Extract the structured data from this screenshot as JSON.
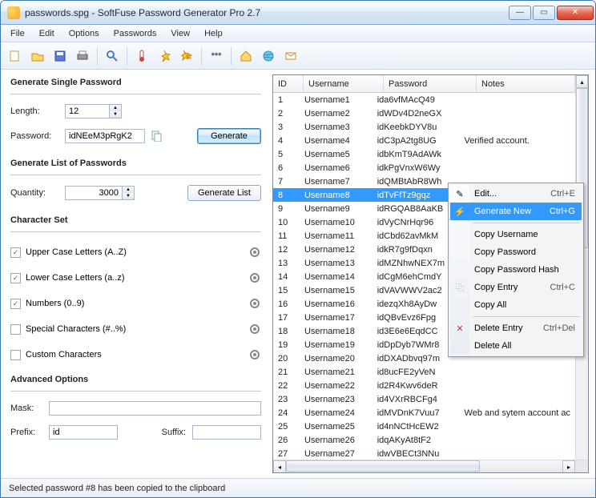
{
  "window": {
    "title": "passwords.spg - SoftFuse Password Generator Pro 2.7"
  },
  "menu": [
    "File",
    "Edit",
    "Options",
    "Passwords",
    "View",
    "Help"
  ],
  "sections": {
    "single": {
      "title": "Generate Single Password",
      "length_label": "Length:",
      "length_value": "12",
      "password_label": "Password:",
      "password_value": "idNEeM3pRgK2",
      "generate": "Generate"
    },
    "list": {
      "title": "Generate List of Passwords",
      "quantity_label": "Quantity:",
      "quantity_value": "3000",
      "generate_list": "Generate List"
    },
    "charset": {
      "title": "Character Set",
      "upper": "Upper Case Letters (A..Z)",
      "lower": "Lower Case Letters (a..z)",
      "numbers": "Numbers (0..9)",
      "special": "Special Characters (#..%)",
      "custom": "Custom Characters"
    },
    "advanced": {
      "title": "Advanced Options",
      "mask_label": "Mask:",
      "mask_value": "",
      "prefix_label": "Prefix:",
      "prefix_value": "id",
      "suffix_label": "Suffix:",
      "suffix_value": ""
    }
  },
  "grid": {
    "headers": [
      "ID",
      "Username",
      "Password",
      "Notes"
    ],
    "selected_index": 7,
    "rows": [
      {
        "id": "1",
        "user": "Username1",
        "pw": "ida6vfMAcQ49",
        "notes": ""
      },
      {
        "id": "2",
        "user": "Username2",
        "pw": "idWDv4D2neGX",
        "notes": ""
      },
      {
        "id": "3",
        "user": "Username3",
        "pw": "idKeebkDYV8u",
        "notes": ""
      },
      {
        "id": "4",
        "user": "Username4",
        "pw": "idC3pA2tg8UG",
        "notes": "Verified account."
      },
      {
        "id": "5",
        "user": "Username5",
        "pw": "idbKmT9AdAWk",
        "notes": ""
      },
      {
        "id": "6",
        "user": "Username6",
        "pw": "idkPgVnxW6Wy",
        "notes": ""
      },
      {
        "id": "7",
        "user": "Username7",
        "pw": "idQMBtAbR8Wh",
        "notes": ""
      },
      {
        "id": "8",
        "user": "Username8",
        "pw": "idTvFfTz9gqz",
        "notes": ""
      },
      {
        "id": "9",
        "user": "Username9",
        "pw": "idRGQAB8AaKB",
        "notes": ""
      },
      {
        "id": "10",
        "user": "Username10",
        "pw": "idVyCNrHqr96",
        "notes": ""
      },
      {
        "id": "11",
        "user": "Username11",
        "pw": "idCbd62avMkM",
        "notes": ""
      },
      {
        "id": "12",
        "user": "Username12",
        "pw": "idkR7g9fDqxn",
        "notes": ""
      },
      {
        "id": "13",
        "user": "Username13",
        "pw": "idMZNhwNEX7m",
        "notes": ""
      },
      {
        "id": "14",
        "user": "Username14",
        "pw": "idCgM6ehCmdY",
        "notes": ""
      },
      {
        "id": "15",
        "user": "Username15",
        "pw": "idVAVWWV2ac2",
        "notes": ""
      },
      {
        "id": "16",
        "user": "Username16",
        "pw": "idezqXh8AyDw",
        "notes": ""
      },
      {
        "id": "17",
        "user": "Username17",
        "pw": "idQBvEvz6Fpg",
        "notes": ""
      },
      {
        "id": "18",
        "user": "Username18",
        "pw": "id3E6e6EqdCC",
        "notes": ""
      },
      {
        "id": "19",
        "user": "Username19",
        "pw": "idDpDyb7WMr8",
        "notes": ""
      },
      {
        "id": "20",
        "user": "Username20",
        "pw": "idDXADbvq97m",
        "notes": ""
      },
      {
        "id": "21",
        "user": "Username21",
        "pw": "id8ucFE2yVeN",
        "notes": ""
      },
      {
        "id": "22",
        "user": "Username22",
        "pw": "id2R4Kwv6deR",
        "notes": ""
      },
      {
        "id": "23",
        "user": "Username23",
        "pw": "id4VXrRBCFg4",
        "notes": ""
      },
      {
        "id": "24",
        "user": "Username24",
        "pw": "idMVDnK7Vuu7",
        "notes": "Web and sytem account ac"
      },
      {
        "id": "25",
        "user": "Username25",
        "pw": "id4nNCtHcEW2",
        "notes": ""
      },
      {
        "id": "26",
        "user": "Username26",
        "pw": "idqAKyAt8tF2",
        "notes": ""
      },
      {
        "id": "27",
        "user": "Username27",
        "pw": "idwVBECt3NNu",
        "notes": ""
      }
    ]
  },
  "context_menu": {
    "items": [
      {
        "icon": "pencil",
        "label": "Edit...",
        "shortcut": "Ctrl+E"
      },
      {
        "icon": "bolt",
        "label": "Generate New",
        "shortcut": "Ctrl+G",
        "hl": true
      },
      {
        "sep": true
      },
      {
        "label": "Copy Username"
      },
      {
        "label": "Copy Password"
      },
      {
        "label": "Copy Password Hash"
      },
      {
        "icon": "copy",
        "label": "Copy Entry",
        "shortcut": "Ctrl+C"
      },
      {
        "label": "Copy All"
      },
      {
        "sep": true
      },
      {
        "icon": "x",
        "label": "Delete Entry",
        "shortcut": "Ctrl+Del"
      },
      {
        "label": "Delete All"
      }
    ]
  },
  "status": "Selected password #8 has been copied to the clipboard"
}
